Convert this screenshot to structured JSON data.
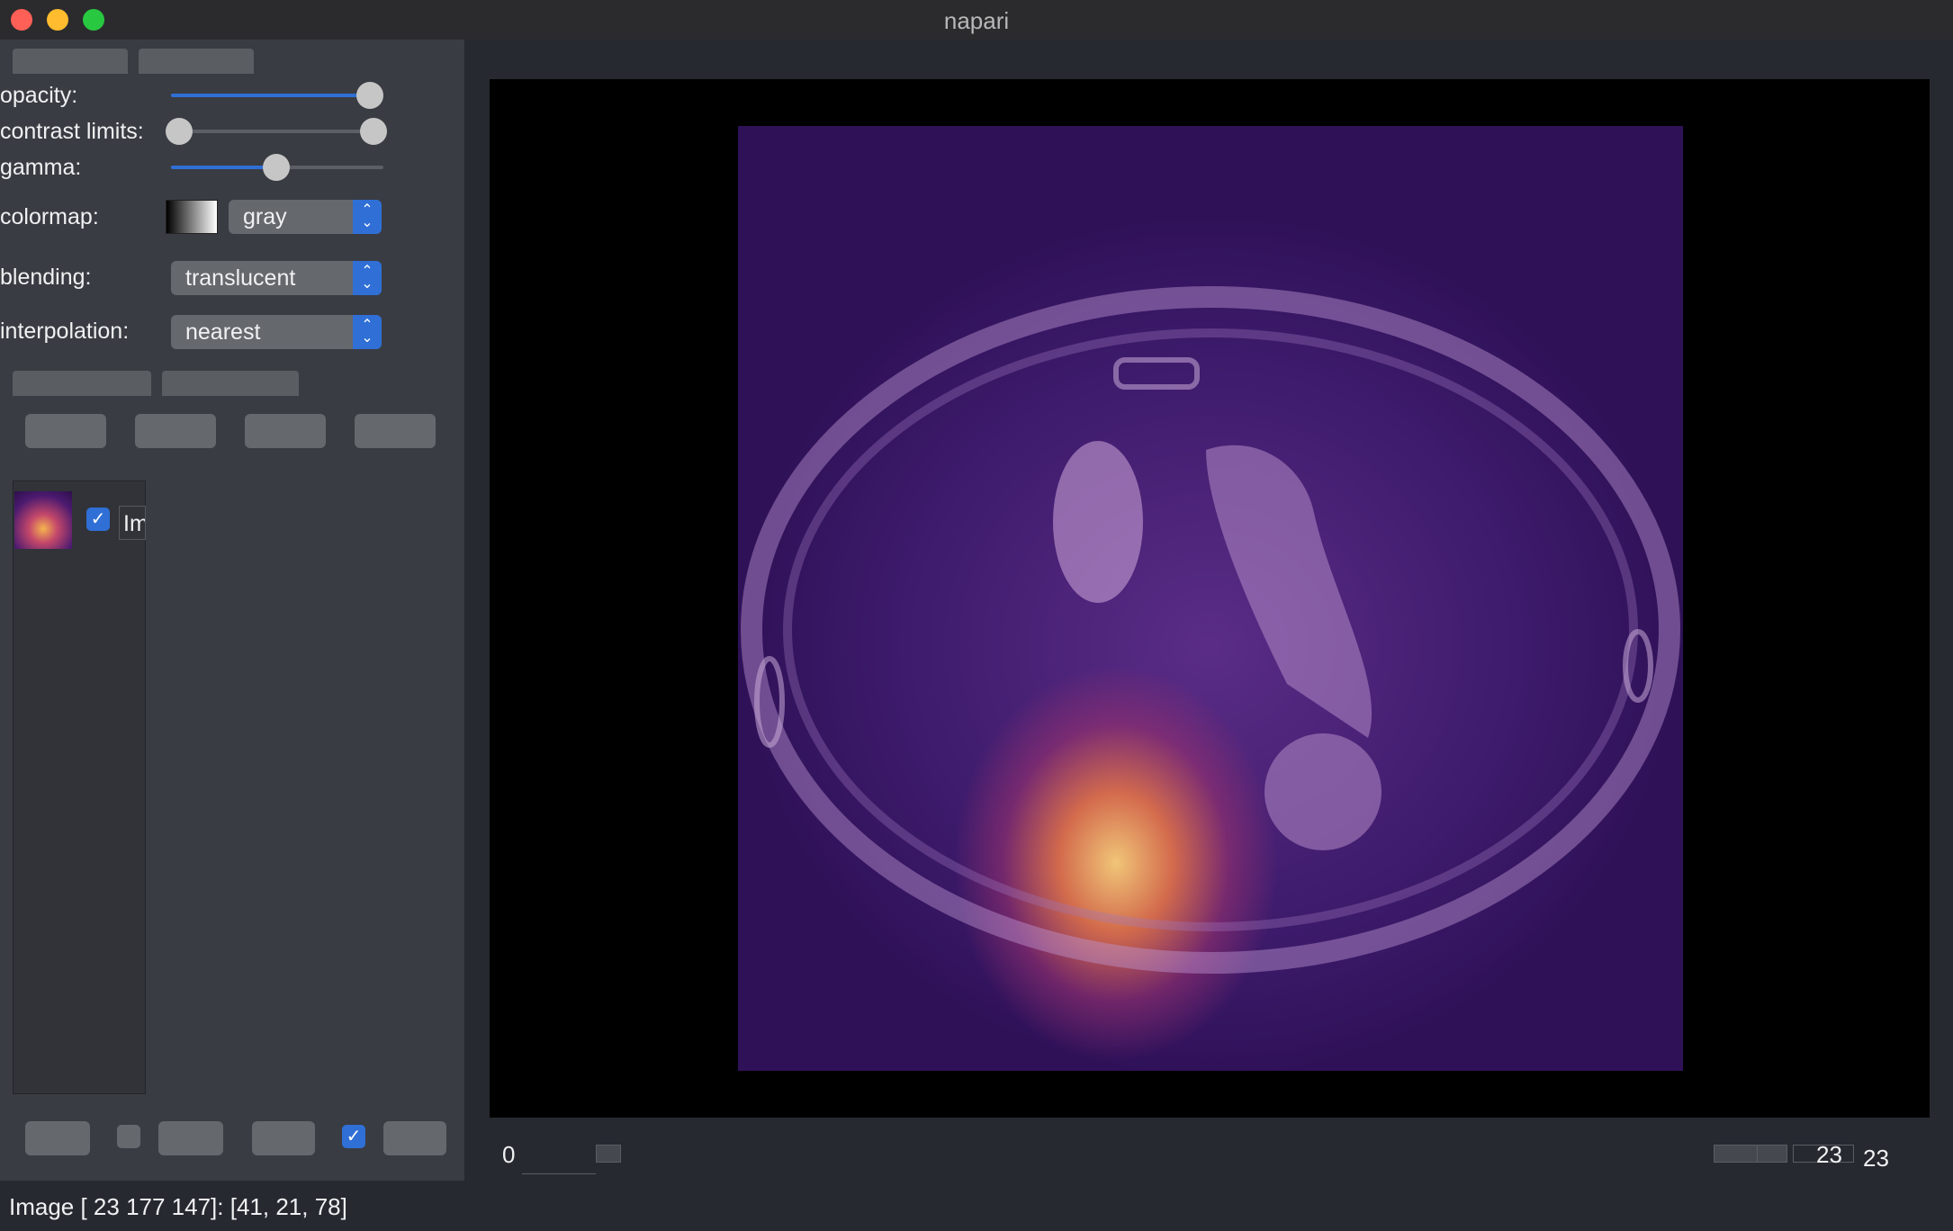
{
  "window": {
    "title": "napari"
  },
  "layer_controls": {
    "opacity": {
      "label": "opacity:",
      "value": 1.0
    },
    "contrast_limits": {
      "label": "contrast limits:",
      "min": 0.0,
      "max": 1.0
    },
    "gamma": {
      "label": "gamma:",
      "value": 0.5
    },
    "colormap": {
      "label": "colormap:",
      "value": "gray"
    },
    "blending": {
      "label": "blending:",
      "value": "translucent"
    },
    "interpolation": {
      "label": "interpolation:",
      "value": "nearest"
    }
  },
  "layer_list": {
    "items": [
      {
        "name": "Im",
        "visible": true
      }
    ]
  },
  "dims": {
    "left_value": "0",
    "right_value": "23",
    "right_total": "23"
  },
  "status": {
    "text": "Image [ 23 177 147]: [41, 21, 78]"
  },
  "colors": {
    "accent": "#2f6fd6",
    "panel": "#393c42",
    "background": "#262930"
  }
}
